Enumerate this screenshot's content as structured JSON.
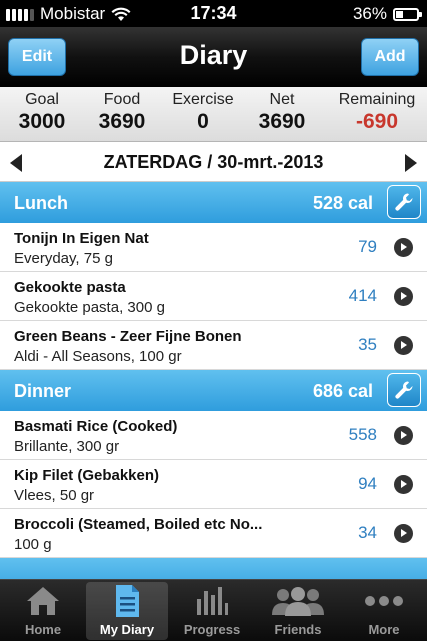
{
  "status": {
    "carrier": "Mobistar",
    "time": "17:34",
    "battery": "36%",
    "battery_level": 0.36
  },
  "nav": {
    "title": "Diary",
    "edit_label": "Edit",
    "add_label": "Add"
  },
  "summary": {
    "goal_label": "Goal",
    "goal": "3000",
    "food_label": "Food",
    "food": "3690",
    "exercise_label": "Exercise",
    "exercise": "0",
    "net_label": "Net",
    "net": "3690",
    "remaining_label": "Remaining",
    "remaining": "-690",
    "remaining_color": "#c8372d"
  },
  "date": "ZATERDAG / 30-mrt.-2013",
  "sections": [
    {
      "name": "Lunch",
      "calories": "528 cal",
      "items": [
        {
          "name": "Tonijn In Eigen Nat",
          "desc": "Everyday, 75 g",
          "cal": "79"
        },
        {
          "name": "Gekookte pasta",
          "desc": "Gekookte pasta, 300 g",
          "cal": "414"
        },
        {
          "name": "Green Beans - Zeer Fijne Bonen",
          "desc": "Aldi - All Seasons, 100 gr",
          "cal": "35"
        }
      ]
    },
    {
      "name": "Dinner",
      "calories": "686 cal",
      "items": [
        {
          "name": "Basmati Rice (Cooked)",
          "desc": "Brillante, 300 gr",
          "cal": "558"
        },
        {
          "name": "Kip Filet (Gebakken)",
          "desc": "Vlees, 50 gr",
          "cal": "94"
        },
        {
          "name": "Broccoli (Steamed, Boiled etc No...",
          "desc": "100 g",
          "cal": "34"
        }
      ]
    }
  ],
  "tabs": [
    {
      "label": "Home",
      "icon": "home-icon"
    },
    {
      "label": "My Diary",
      "icon": "diary-icon"
    },
    {
      "label": "Progress",
      "icon": "bar-chart-icon"
    },
    {
      "label": "Friends",
      "icon": "friends-icon"
    },
    {
      "label": "More",
      "icon": "more-icon"
    }
  ],
  "colors": {
    "section_blue": "#3ea2e0",
    "calorie_blue": "#2f7fc0"
  }
}
